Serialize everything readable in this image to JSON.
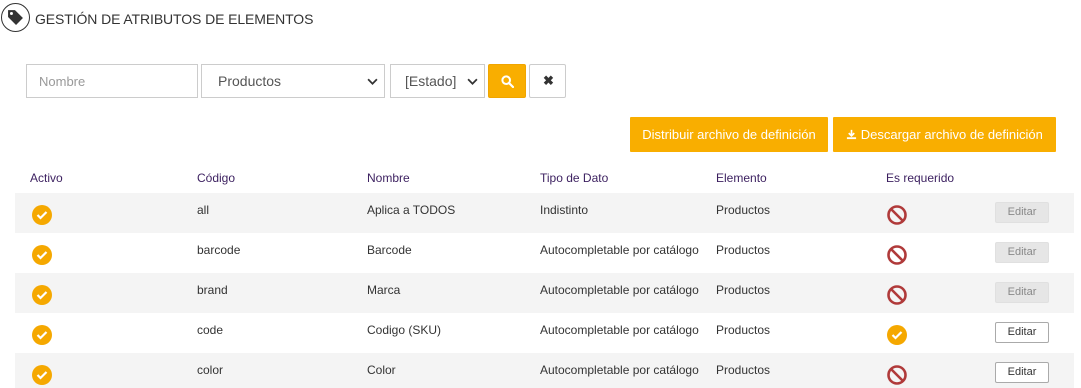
{
  "page": {
    "title": "GESTIÓN DE ATRIBUTOS DE ELEMENTOS",
    "title_icon": "tag-icon"
  },
  "filters": {
    "name_placeholder": "Nombre",
    "name_value": "",
    "element_select": "Productos",
    "state_select": "[Estado]",
    "search_icon": "search-icon",
    "clear_icon": "close-icon",
    "clear_label": "✖"
  },
  "actions": {
    "distribute_label": "Distribuir archivo de definición",
    "download_label": "Descargar archivo de definición",
    "download_icon": "download-icon"
  },
  "colors": {
    "accent": "#f9ae00",
    "header_text": "#3b1f5f",
    "forbidden": "#b03a3a"
  },
  "table": {
    "headers": [
      "Activo",
      "Código",
      "Nombre",
      "Tipo de Dato",
      "Elemento",
      "Es requerido"
    ],
    "rows": [
      {
        "active": true,
        "code": "all",
        "name": "Aplica a TODOS",
        "type": "Indistinto",
        "element": "Productos",
        "required": false,
        "edit_label": "Editar",
        "edit_enabled": false
      },
      {
        "active": true,
        "code": "barcode",
        "name": "Barcode",
        "type": "Autocompletable por catálogo",
        "element": "Productos",
        "required": false,
        "edit_label": "Editar",
        "edit_enabled": false
      },
      {
        "active": true,
        "code": "brand",
        "name": "Marca",
        "type": "Autocompletable por catálogo",
        "element": "Productos",
        "required": false,
        "edit_label": "Editar",
        "edit_enabled": false
      },
      {
        "active": true,
        "code": "code",
        "name": "Codigo (SKU)",
        "type": "Autocompletable por catálogo",
        "element": "Productos",
        "required": true,
        "edit_label": "Editar",
        "edit_enabled": true
      },
      {
        "active": true,
        "code": "color",
        "name": "Color",
        "type": "Autocompletable por catálogo",
        "element": "Productos",
        "required": false,
        "edit_label": "Editar",
        "edit_enabled": true
      }
    ]
  }
}
